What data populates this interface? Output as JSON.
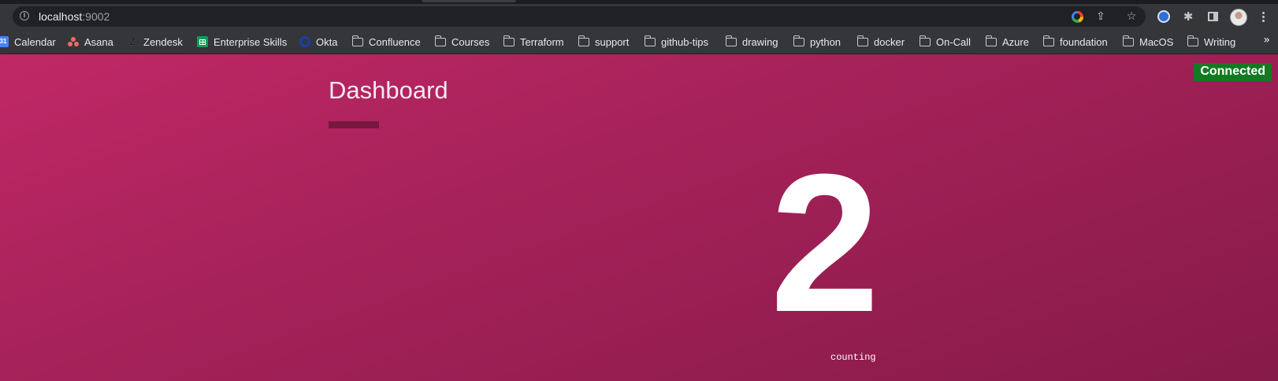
{
  "browser": {
    "url_host": "localhost",
    "url_port": ":9002",
    "icons": [
      "info-icon",
      "google-icon",
      "share-icon",
      "star-icon",
      "extension-icon",
      "puzzle-icon",
      "side-panel-icon",
      "avatar",
      "menu-icon"
    ]
  },
  "bookmarks": [
    {
      "label": "Calendar",
      "icon": "calendar-icon"
    },
    {
      "label": "Asana",
      "icon": "asana-icon"
    },
    {
      "label": "Zendesk",
      "icon": "zendesk-icon"
    },
    {
      "label": "Enterprise Skills",
      "icon": "sheets-icon"
    },
    {
      "label": "Okta",
      "icon": "okta-icon"
    },
    {
      "label": "Confluence",
      "icon": "folder-icon"
    },
    {
      "label": "Courses",
      "icon": "folder-icon"
    },
    {
      "label": "Terraform",
      "icon": "folder-icon"
    },
    {
      "label": "support",
      "icon": "folder-icon"
    },
    {
      "label": "github-tips",
      "icon": "folder-icon"
    },
    {
      "label": "drawing",
      "icon": "folder-icon"
    },
    {
      "label": "python",
      "icon": "folder-icon"
    },
    {
      "label": "docker",
      "icon": "folder-icon"
    },
    {
      "label": "On-Call",
      "icon": "folder-icon"
    },
    {
      "label": "Azure",
      "icon": "folder-icon"
    },
    {
      "label": "foundation",
      "icon": "folder-icon"
    },
    {
      "label": "MacOS",
      "icon": "folder-icon"
    },
    {
      "label": "Writing",
      "icon": "folder-icon"
    }
  ],
  "bookmarks_overflow": "»",
  "dashboard": {
    "title": "Dashboard",
    "count": "2",
    "count_label": "counting",
    "status": "Connected"
  },
  "colors": {
    "background_start": "#c02866",
    "background_end": "#861a48",
    "status_green": "#137a22"
  }
}
